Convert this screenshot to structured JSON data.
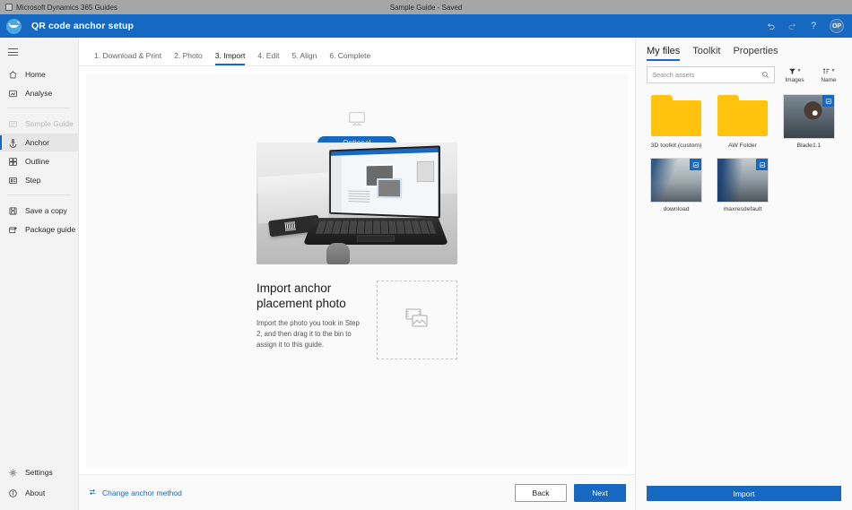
{
  "os_titlebar": {
    "app_name": "Microsoft Dynamics 365 Guides",
    "document_title": "Sample Guide - Saved"
  },
  "app_header": {
    "title": "QR code anchor setup",
    "undo_label": "Undo",
    "redo_label": "Redo",
    "help_label": "?",
    "avatar_initials": "OP",
    "brand_color": "#1668c1"
  },
  "sidebar": {
    "menu_label": "Menu",
    "items": [
      {
        "label": "Home",
        "icon": "home-icon",
        "state": "normal"
      },
      {
        "label": "Analyse",
        "icon": "analyse-icon",
        "state": "normal"
      }
    ],
    "guide_section": [
      {
        "label": "Sample Guide",
        "icon": "guide-icon",
        "state": "dimmed"
      },
      {
        "label": "Anchor",
        "icon": "anchor-icon",
        "state": "selected"
      },
      {
        "label": "Outline",
        "icon": "outline-icon",
        "state": "normal"
      },
      {
        "label": "Step",
        "icon": "step-icon",
        "state": "normal"
      }
    ],
    "actions": [
      {
        "label": "Save a copy",
        "icon": "save-copy-icon",
        "state": "normal"
      },
      {
        "label": "Package guide",
        "icon": "package-icon",
        "state": "normal"
      }
    ],
    "bottom": [
      {
        "label": "Settings",
        "icon": "gear-icon",
        "state": "normal"
      },
      {
        "label": "About",
        "icon": "info-icon",
        "state": "normal"
      }
    ]
  },
  "wizard": {
    "tabs": [
      {
        "label": "1. Download & Print",
        "active": false
      },
      {
        "label": "2. Photo",
        "active": false
      },
      {
        "label": "3. Import",
        "active": true
      },
      {
        "label": "4. Edit",
        "active": false
      },
      {
        "label": "5. Align",
        "active": false
      },
      {
        "label": "6. Complete",
        "active": false
      }
    ],
    "badge": "Optional",
    "device_icon": "desktop-pc-icon",
    "heading": "Import anchor placement photo",
    "description": "Import the photo you took in Step 2, and then drag it to the bin to assign it to this guide.",
    "dropzone_icon": "image-placeholder-icon"
  },
  "footer": {
    "change_method_label": "Change anchor method",
    "change_method_icon": "swap-icon",
    "back_label": "Back",
    "next_label": "Next"
  },
  "right_panel": {
    "tabs": [
      {
        "label": "My files",
        "active": true
      },
      {
        "label": "Toolkit",
        "active": false
      },
      {
        "label": "Properties",
        "active": false
      }
    ],
    "search": {
      "placeholder": "Search assets",
      "value": "",
      "icon": "search-icon"
    },
    "filter": {
      "label": "Images",
      "icon": "filter-icon"
    },
    "sort": {
      "label": "Name",
      "icon": "sort-icon"
    },
    "files": [
      {
        "name": "3D toolkit (custom)",
        "type": "folder",
        "badge": false
      },
      {
        "name": "AW Folder",
        "type": "folder",
        "badge": false
      },
      {
        "name": "Blade1.1",
        "type": "image",
        "badge": true,
        "art": "art-person"
      },
      {
        "name": "download",
        "type": "image",
        "badge": true,
        "art": "art-work1"
      },
      {
        "name": "maxresdefault",
        "type": "image",
        "badge": true,
        "art": "art-work2"
      }
    ],
    "import_label": "Import"
  }
}
